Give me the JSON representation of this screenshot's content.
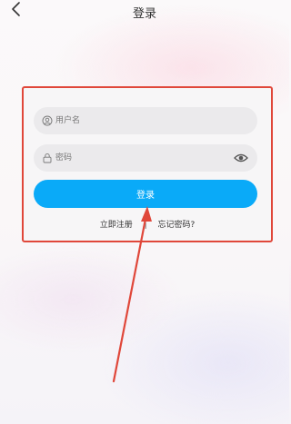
{
  "header": {
    "title": "登录",
    "back_icon": "chevron-left-icon"
  },
  "form": {
    "username_placeholder": "用户名",
    "username_icon": "user-circle-icon",
    "password_placeholder": "密码",
    "password_icon": "lock-icon",
    "password_toggle_icon": "eye-icon",
    "login_label": "登录",
    "register_link": "立即注册",
    "separator": "|",
    "forgot_link": "忘记密码?"
  },
  "colors": {
    "primary": "#0aaaf8",
    "highlight": "#e0473a"
  }
}
